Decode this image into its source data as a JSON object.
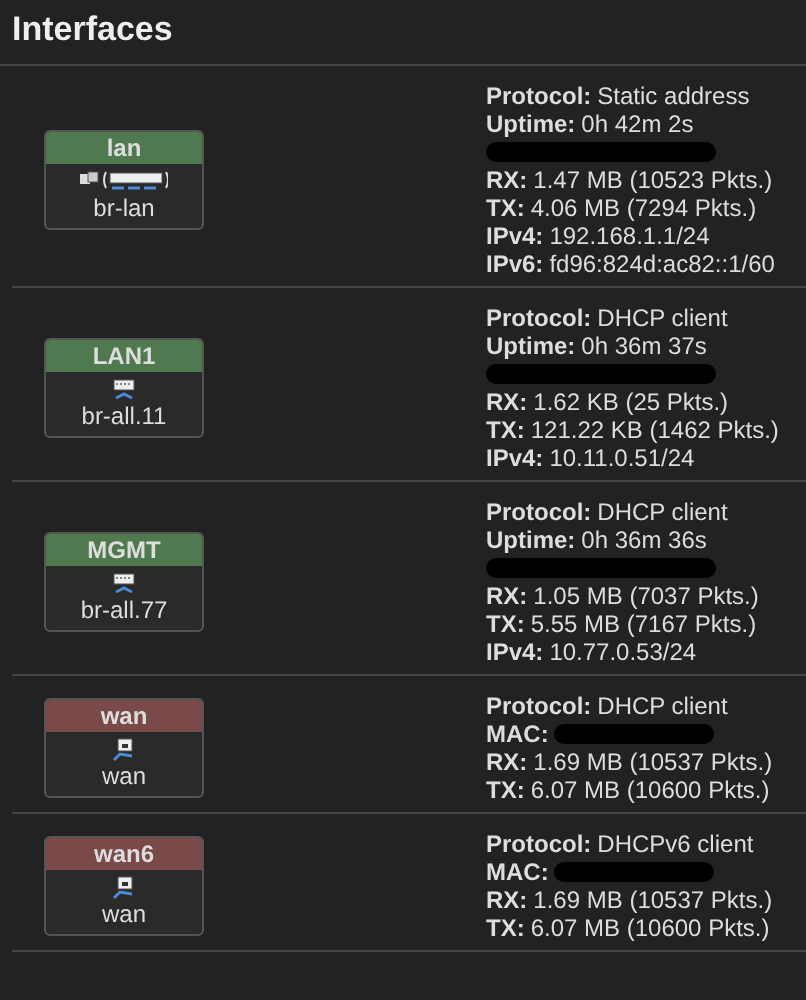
{
  "title": "Interfaces",
  "interfaces": [
    {
      "name": "lan",
      "color": "#4f7a4f",
      "kind": "bridge",
      "device": "br-lan",
      "details": [
        {
          "label": "Protocol:",
          "value": "Static address"
        },
        {
          "label": "Uptime:",
          "value": "0h 42m 2s"
        },
        {
          "kind": "redacted"
        },
        {
          "label": "RX:",
          "value": "1.47 MB (10523 Pkts.)"
        },
        {
          "label": "TX:",
          "value": "4.06 MB (7294 Pkts.)"
        },
        {
          "label": "IPv4:",
          "value": "192.168.1.1/24"
        },
        {
          "label": "IPv6:",
          "value": "fd96:824d:ac82::1/60"
        }
      ]
    },
    {
      "name": "LAN1",
      "color": "#4f7a4f",
      "kind": "switch",
      "device": "br-all.11",
      "details": [
        {
          "label": "Protocol:",
          "value": "DHCP client"
        },
        {
          "label": "Uptime:",
          "value": "0h 36m 37s"
        },
        {
          "kind": "redacted"
        },
        {
          "label": "RX:",
          "value": "1.62 KB (25 Pkts.)"
        },
        {
          "label": "TX:",
          "value": "121.22 KB (1462 Pkts.)"
        },
        {
          "label": "IPv4:",
          "value": "10.11.0.51/24"
        }
      ]
    },
    {
      "name": "MGMT",
      "color": "#4f7a4f",
      "kind": "switch",
      "device": "br-all.77",
      "details": [
        {
          "label": "Protocol:",
          "value": "DHCP client"
        },
        {
          "label": "Uptime:",
          "value": "0h 36m 36s"
        },
        {
          "kind": "redacted"
        },
        {
          "label": "RX:",
          "value": "1.05 MB (7037 Pkts.)"
        },
        {
          "label": "TX:",
          "value": "5.55 MB (7167 Pkts.)"
        },
        {
          "label": "IPv4:",
          "value": "10.77.0.53/24"
        }
      ]
    },
    {
      "name": "wan",
      "color": "#7a4a4a",
      "kind": "port",
      "device": "wan",
      "details": [
        {
          "label": "Protocol:",
          "value": "DHCP client"
        },
        {
          "label": "MAC:",
          "kind": "redacted"
        },
        {
          "label": "RX:",
          "value": "1.69 MB (10537 Pkts.)"
        },
        {
          "label": "TX:",
          "value": "6.07 MB (10600 Pkts.)"
        }
      ]
    },
    {
      "name": "wan6",
      "color": "#7a4a4a",
      "kind": "port",
      "device": "wan",
      "details": [
        {
          "label": "Protocol:",
          "value": "DHCPv6 client"
        },
        {
          "label": "MAC:",
          "kind": "redacted"
        },
        {
          "label": "RX:",
          "value": "1.69 MB (10537 Pkts.)"
        },
        {
          "label": "TX:",
          "value": "6.07 MB (10600 Pkts.)"
        }
      ]
    }
  ]
}
